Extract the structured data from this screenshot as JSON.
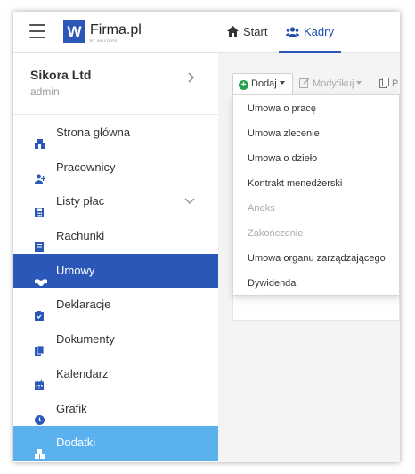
{
  "brand": {
    "logo_letter": "W",
    "name": "Firma.pl",
    "tagline": "BY WOLTERS"
  },
  "topnav": {
    "tabs": [
      {
        "label": "Start",
        "icon": "home-icon"
      },
      {
        "label": "Kadry",
        "icon": "users-icon",
        "active": true
      }
    ]
  },
  "company": {
    "name": "Sikora Ltd",
    "role": "admin"
  },
  "sidebar": {
    "items": [
      {
        "label": "Strona główna",
        "icon": "home-menu-icon"
      },
      {
        "label": "Pracownicy",
        "icon": "user-add-icon"
      },
      {
        "label": "Listy płac",
        "icon": "calculator-icon",
        "has_submenu": true
      },
      {
        "label": "Rachunki",
        "icon": "receipt-icon"
      },
      {
        "label": "Umowy",
        "icon": "handshake-icon",
        "active": true
      },
      {
        "label": "Deklaracje",
        "icon": "clipboard-check-icon"
      },
      {
        "label": "Dokumenty",
        "icon": "documents-icon"
      },
      {
        "label": "Kalendarz",
        "icon": "calendar-icon"
      },
      {
        "label": "Grafik",
        "icon": "clock-icon"
      },
      {
        "label": "Dodatki",
        "icon": "boxes-icon",
        "highlight": true
      }
    ]
  },
  "toolbar": {
    "add_label": "Dodaj",
    "modify_label": "Modyfikuj",
    "third_label": "P"
  },
  "dropdown": {
    "items": [
      {
        "label": "Umowa o pracę",
        "disabled": false
      },
      {
        "label": "Umowa zlecenie",
        "disabled": false
      },
      {
        "label": "Umowa o dzieło",
        "disabled": false
      },
      {
        "label": "Kontrakt menedżerski",
        "disabled": false
      },
      {
        "label": "Aneks",
        "disabled": true
      },
      {
        "label": "Zakończenie",
        "disabled": true
      },
      {
        "label": "Umowa organu zarządzającego",
        "disabled": false
      },
      {
        "label": "Dywidenda",
        "disabled": false
      }
    ]
  },
  "colors": {
    "primary": "#2a57b8",
    "active_bg": "#2a57b8",
    "highlight_bg": "#5ab1ee",
    "add_green": "#2aa14e"
  }
}
